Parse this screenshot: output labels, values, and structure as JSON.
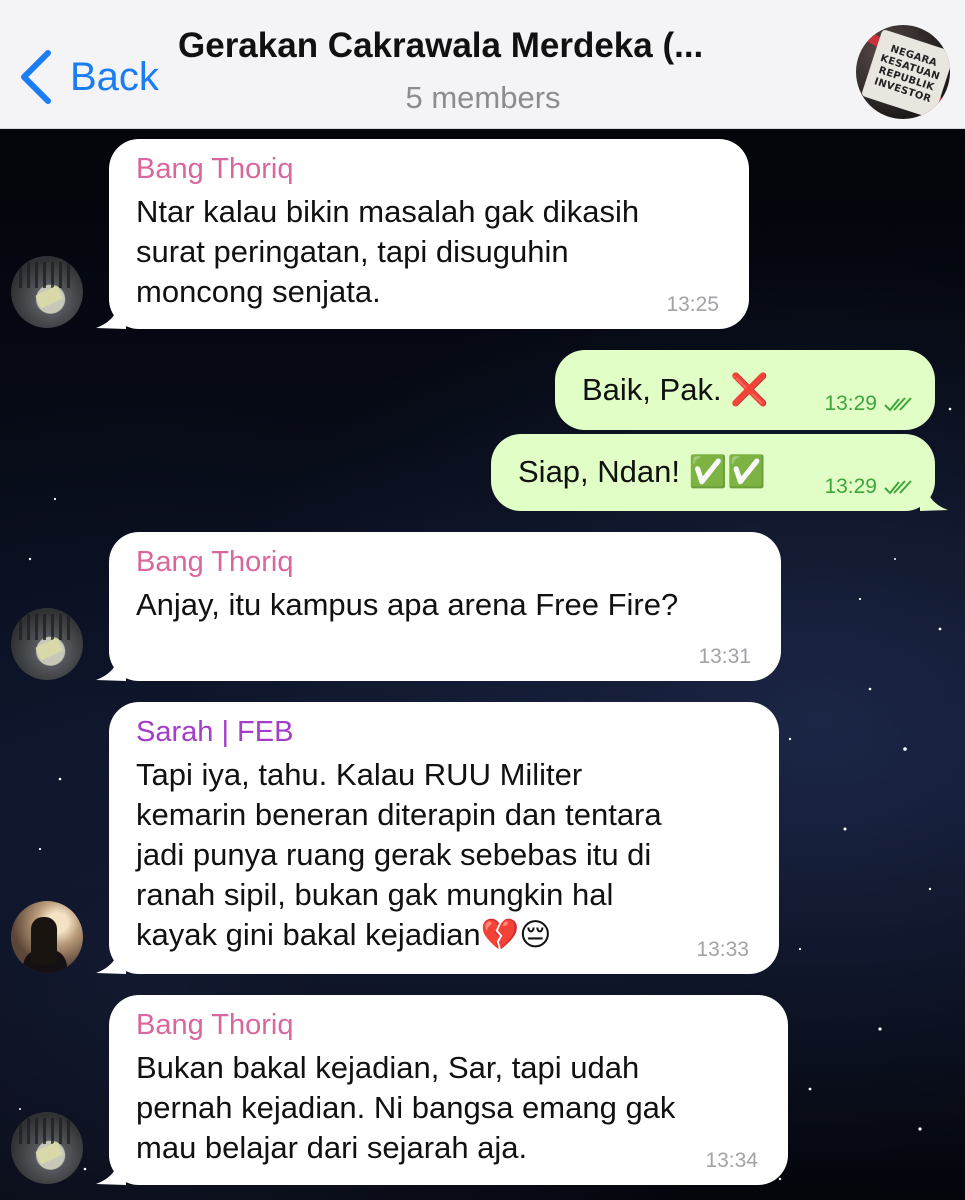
{
  "header": {
    "back_label": "Back",
    "title": "Gerakan Cakrawala Merdeka (...",
    "subtitle": "5 members",
    "group_avatar_text": [
      "NEGARA",
      "KESATUAN",
      "REPUBLIK",
      "INVESTOR"
    ]
  },
  "messages": [
    {
      "direction": "in",
      "sender": "Bang Thoriq",
      "text": "Ntar kalau bikin masalah gak dikasih\nsurat peringatan, tapi disuguhin\nmoncong senjata.",
      "time": "13:25"
    },
    {
      "direction": "out",
      "text": "Baik, Pak. ❌",
      "time": "13:29",
      "status": "read"
    },
    {
      "direction": "out",
      "text": "Siap, Ndan! ✅✅",
      "time": "13:29",
      "status": "read"
    },
    {
      "direction": "in",
      "sender": "Bang Thoriq",
      "text": "Anjay, itu kampus apa arena Free Fire?",
      "time": "13:31"
    },
    {
      "direction": "in",
      "sender": "Sarah | FEB",
      "text": "Tapi iya, tahu. Kalau RUU Militer\nkemarin beneran diterapin dan tentara\njadi punya ruang gerak sebebas itu di\nranah sipil, bukan gak mungkin hal\nkayak gini bakal kejadian💔😔",
      "time": "13:33"
    },
    {
      "direction": "in",
      "sender": "Bang Thoriq",
      "text": "Bukan bakal kejadian, Sar, tapi udah\npernah kejadian. Ni bangsa emang gak\nmau belajar dari sejarah aja.",
      "time": "13:34"
    }
  ],
  "colors": {
    "accent": "#1c7df2",
    "incoming_bubble": "#ffffff",
    "outgoing_bubble": "#e1fec6",
    "sender_thoriq": "#d9679e",
    "sender_sarah": "#a43dc9",
    "outgoing_time": "#3ea63a"
  }
}
